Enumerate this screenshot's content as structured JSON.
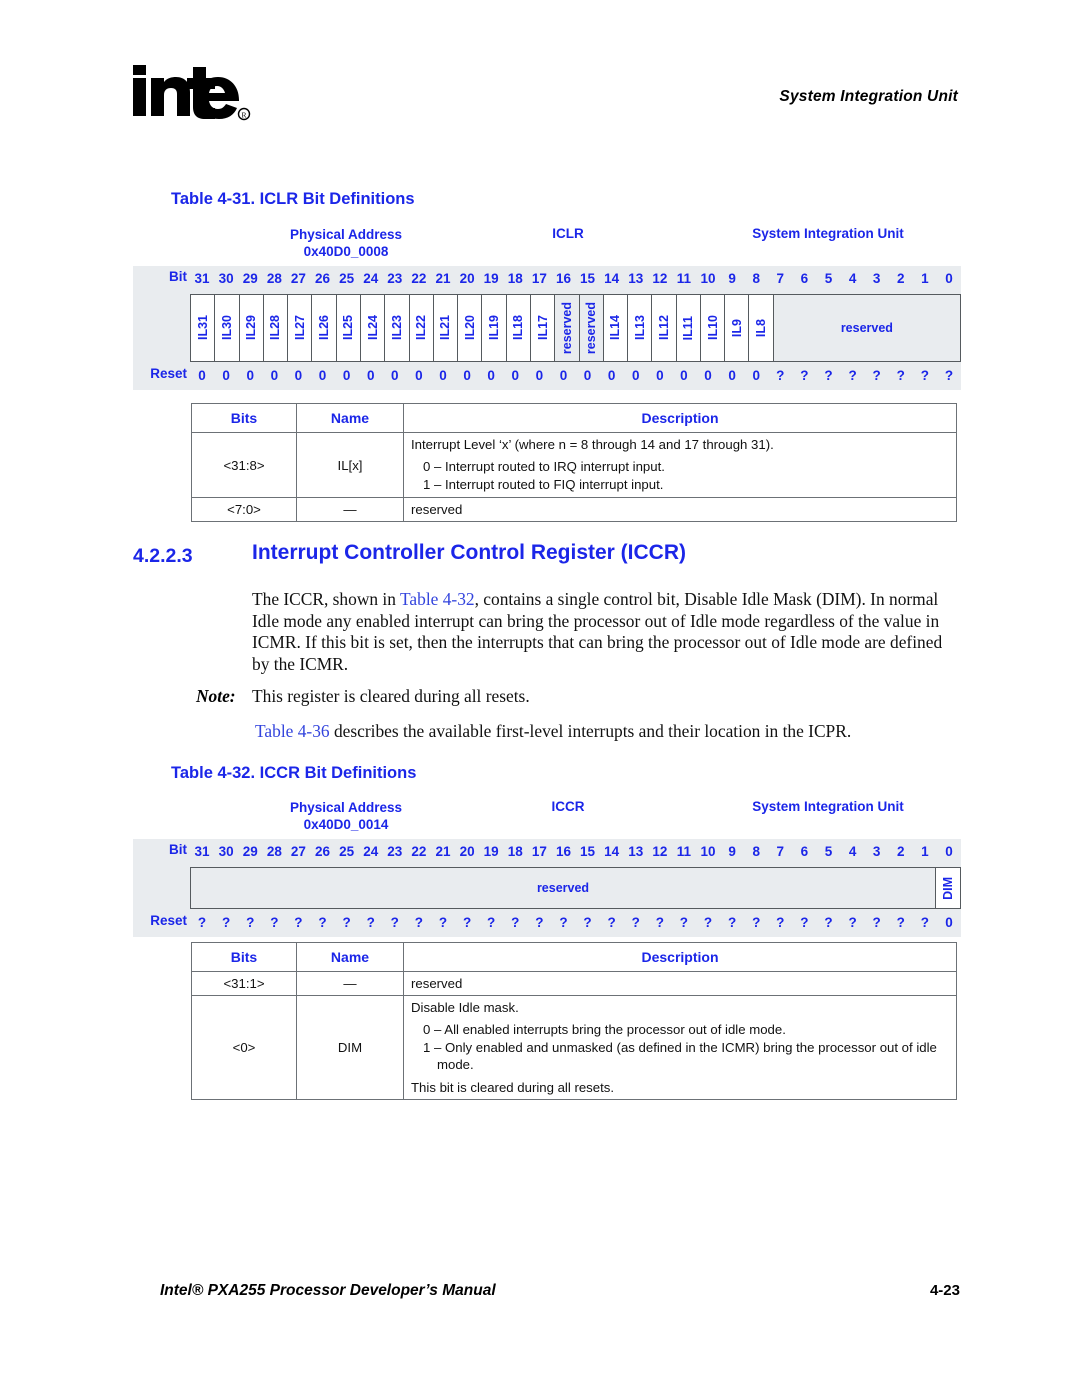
{
  "header": {
    "logo_alt": "intel",
    "running_head": "System Integration Unit"
  },
  "footer": {
    "manual_title": "Intel® PXA255 Processor Developer’s Manual",
    "page_number": "4-23"
  },
  "colors": {
    "accent_blue": "#1b26e8",
    "link_blue": "#3344dd",
    "band_gray": "#e9ecef",
    "border_gray": "#555a5e"
  },
  "table_iclr": {
    "caption": "Table 4-31. ICLR Bit Definitions",
    "physical_address_label": "Physical Address",
    "physical_address_value": "0x40D0_0008",
    "register_name": "ICLR",
    "unit_name": "System Integration Unit",
    "bit_row_label": "Bit",
    "reset_row_label": "Reset",
    "bit_numbers": [
      "31",
      "30",
      "29",
      "28",
      "27",
      "26",
      "25",
      "24",
      "23",
      "22",
      "21",
      "20",
      "19",
      "18",
      "17",
      "16",
      "15",
      "14",
      "13",
      "12",
      "11",
      "10",
      "9",
      "8",
      "7",
      "6",
      "5",
      "4",
      "3",
      "2",
      "1",
      "0"
    ],
    "fields": [
      {
        "label": "IL31",
        "span": 1,
        "style": "vertical",
        "shaded": false
      },
      {
        "label": "IL30",
        "span": 1,
        "style": "vertical",
        "shaded": false
      },
      {
        "label": "IL29",
        "span": 1,
        "style": "vertical",
        "shaded": false
      },
      {
        "label": "IL28",
        "span": 1,
        "style": "vertical",
        "shaded": false
      },
      {
        "label": "IL27",
        "span": 1,
        "style": "vertical",
        "shaded": false
      },
      {
        "label": "IL26",
        "span": 1,
        "style": "vertical",
        "shaded": false
      },
      {
        "label": "IL25",
        "span": 1,
        "style": "vertical",
        "shaded": false
      },
      {
        "label": "IL24",
        "span": 1,
        "style": "vertical",
        "shaded": false
      },
      {
        "label": "IL23",
        "span": 1,
        "style": "vertical",
        "shaded": false
      },
      {
        "label": "IL22",
        "span": 1,
        "style": "vertical",
        "shaded": false
      },
      {
        "label": "IL21",
        "span": 1,
        "style": "vertical",
        "shaded": false
      },
      {
        "label": "IL20",
        "span": 1,
        "style": "vertical",
        "shaded": false
      },
      {
        "label": "IL19",
        "span": 1,
        "style": "vertical",
        "shaded": false
      },
      {
        "label": "IL18",
        "span": 1,
        "style": "vertical",
        "shaded": false
      },
      {
        "label": "IL17",
        "span": 1,
        "style": "vertical",
        "shaded": false
      },
      {
        "label": "reserved",
        "span": 1,
        "style": "vertical",
        "shaded": true
      },
      {
        "label": "reserved",
        "span": 1,
        "style": "vertical",
        "shaded": true
      },
      {
        "label": "IL14",
        "span": 1,
        "style": "vertical",
        "shaded": false
      },
      {
        "label": "IL13",
        "span": 1,
        "style": "vertical",
        "shaded": false
      },
      {
        "label": "IL12",
        "span": 1,
        "style": "vertical",
        "shaded": false
      },
      {
        "label": "IL11",
        "span": 1,
        "style": "vertical",
        "shaded": false
      },
      {
        "label": "IL10",
        "span": 1,
        "style": "vertical",
        "shaded": false
      },
      {
        "label": "IL9",
        "span": 1,
        "style": "vertical",
        "shaded": false
      },
      {
        "label": "IL8",
        "span": 1,
        "style": "vertical",
        "shaded": false
      },
      {
        "label": "reserved",
        "span": 8,
        "style": "horizontal",
        "shaded": true
      }
    ],
    "reset_values": [
      "0",
      "0",
      "0",
      "0",
      "0",
      "0",
      "0",
      "0",
      "0",
      "0",
      "0",
      "0",
      "0",
      "0",
      "0",
      "0",
      "0",
      "0",
      "0",
      "0",
      "0",
      "0",
      "0",
      "0",
      "?",
      "?",
      "?",
      "?",
      "?",
      "?",
      "?",
      "?"
    ],
    "desc_headers": [
      "Bits",
      "Name",
      "Description"
    ],
    "desc_rows": [
      {
        "bits": "<31:8>",
        "name": "IL[x]",
        "desc_lines": [
          "Interrupt Level ‘x’ (where n = 8 through 14 and 17 through 31).",
          "0 –  Interrupt routed to IRQ interrupt input.",
          "1 –  Interrupt routed to FIQ interrupt input."
        ]
      },
      {
        "bits": "<7:0>",
        "name": "—",
        "desc_lines": [
          "reserved"
        ]
      }
    ]
  },
  "section": {
    "number": "4.2.2.3",
    "title": "Interrupt Controller Control Register (ICCR)",
    "paragraph_pre": "The ICCR, shown in ",
    "paragraph_link": "Table 4-32",
    "paragraph_post": ", contains a single control bit, Disable Idle Mask (DIM). In normal Idle mode any enabled interrupt can bring the processor out of Idle mode regardless of the value in ICMR. If this bit is set, then the interrupts that can bring the processor out of Idle mode are defined by the ICMR.",
    "note_label": "Note:",
    "note_text": "This register is cleared during all resets.",
    "followup_link": "Table 4-36",
    "followup_text": " describes the available first-level interrupts and their location in the ICPR."
  },
  "table_iccr": {
    "caption": "Table 4-32. ICCR Bit Definitions",
    "physical_address_label": "Physical Address",
    "physical_address_value": "0x40D0_0014",
    "register_name": "ICCR",
    "unit_name": "System Integration Unit",
    "bit_row_label": "Bit",
    "reset_row_label": "Reset",
    "bit_numbers": [
      "31",
      "30",
      "29",
      "28",
      "27",
      "26",
      "25",
      "24",
      "23",
      "22",
      "21",
      "20",
      "19",
      "18",
      "17",
      "16",
      "15",
      "14",
      "13",
      "12",
      "11",
      "10",
      "9",
      "8",
      "7",
      "6",
      "5",
      "4",
      "3",
      "2",
      "1",
      "0"
    ],
    "fields": [
      {
        "label": "reserved",
        "span": 31,
        "style": "horizontal",
        "shaded": true
      },
      {
        "label": "DIM",
        "span": 1,
        "style": "vertical",
        "shaded": false
      }
    ],
    "reset_values": [
      "?",
      "?",
      "?",
      "?",
      "?",
      "?",
      "?",
      "?",
      "?",
      "?",
      "?",
      "?",
      "?",
      "?",
      "?",
      "?",
      "?",
      "?",
      "?",
      "?",
      "?",
      "?",
      "?",
      "?",
      "?",
      "?",
      "?",
      "?",
      "?",
      "?",
      "?",
      "0"
    ],
    "desc_headers": [
      "Bits",
      "Name",
      "Description"
    ],
    "desc_rows": [
      {
        "bits": "<31:1>",
        "name": "—",
        "desc_lines": [
          "reserved"
        ]
      },
      {
        "bits": "<0>",
        "name": "DIM",
        "desc_lines": [
          "Disable Idle mask.",
          "0 –  All enabled interrupts bring the processor out of idle mode.",
          "1 –  Only enabled and unmasked (as defined in the ICMR) bring the processor out of idle mode.",
          "This bit is cleared during all resets."
        ]
      }
    ]
  }
}
